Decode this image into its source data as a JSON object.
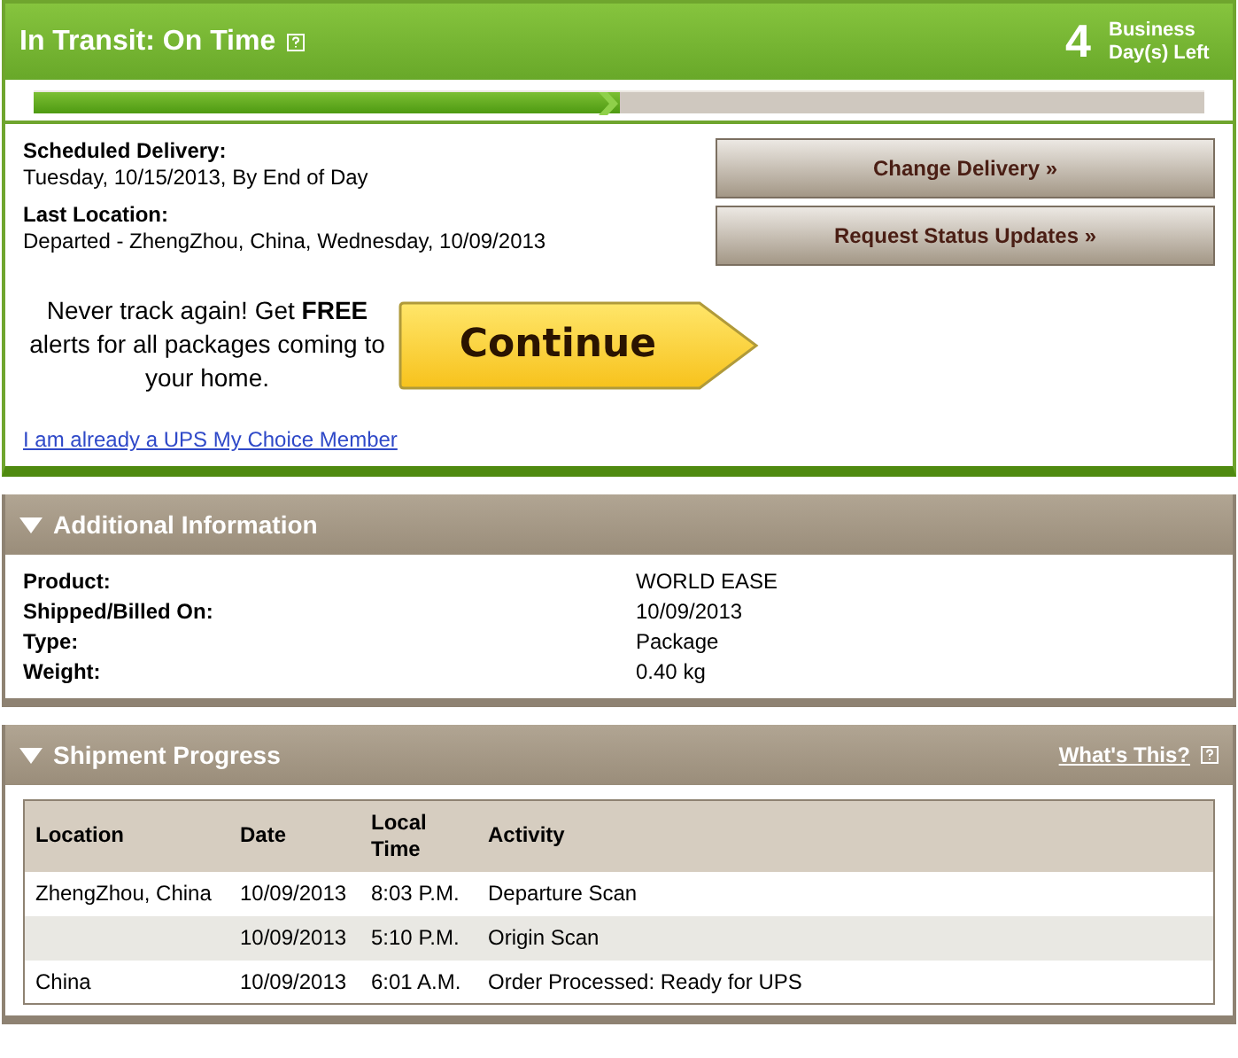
{
  "status": {
    "title": "In Transit: On Time",
    "days_count": "4",
    "days_label": "Business Day(s) Left",
    "progress": {
      "level": 0.5
    }
  },
  "delivery": [
    {
      "label": "Scheduled Delivery:",
      "value": "Tuesday, 10/15/2013, By End of Day"
    },
    {
      "label": "Last Location:",
      "value": "Departed - ZhengZhou, China, Wednesday, 10/09/2013"
    }
  ],
  "actions": [
    "Change Delivery »",
    "Request Status Updates »"
  ],
  "promo": {
    "text": "Never track again! Get **FREE** alerts for all packages coming to your home.",
    "button": "Continue",
    "link": "I am already a UPS My Choice Member"
  },
  "additional_information": {
    "title": "Additional Information",
    "expanded": true,
    "rows": [
      {
        "label": "Product:",
        "value": "WORLD EASE"
      },
      {
        "label": "Shipped/Billed On:",
        "value": "10/09/2013"
      },
      {
        "label": "Type:",
        "value": "Package"
      },
      {
        "label": "Weight:",
        "value": "0.40 kg"
      }
    ]
  },
  "shipment_progress": {
    "title": "Shipment Progress",
    "expanded": true,
    "help_link": "What's This?",
    "columns": [
      "Location",
      "Date",
      "Local Time",
      "Activity"
    ],
    "rows": [
      [
        "ZhengZhou, China",
        "10/09/2013",
        "8:03 P.M.",
        "Departure Scan"
      ],
      [
        "",
        "10/09/2013",
        "5:10 P.M.",
        "Origin Scan"
      ],
      [
        "China",
        "10/09/2013",
        "6:01 A.M.",
        "Order Processed: Ready for UPS"
      ]
    ]
  }
}
